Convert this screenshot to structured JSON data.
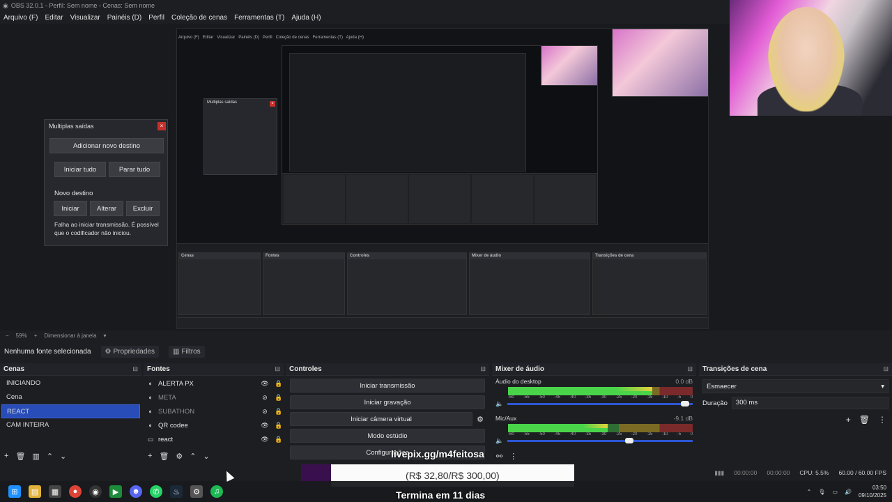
{
  "window": {
    "title": "OBS 32.0.1 - Perfil: Sem nome - Cenas: Sem nome"
  },
  "menu": [
    "Arquivo (F)",
    "Editar",
    "Visualizar",
    "Painéis (D)",
    "Perfil",
    "Coleção de cenas",
    "Ferramentas (T)",
    "Ajuda (H)"
  ],
  "dialog": {
    "title": "Multiplas saídas",
    "add_dest": "Adicionar novo destino",
    "start_all": "Iniciar tudo",
    "stop_all": "Parar tudo",
    "new_dest": "Novo destino",
    "start": "Iniciar",
    "change": "Alterar",
    "delete": "Excluir",
    "error": "Falha ao iniciar transmissão. É possível que o codificador não iniciou."
  },
  "zoom": {
    "value": "59%",
    "mode": "Dimensionar à janela"
  },
  "source_toolbar": {
    "no_source": "Nenhuma fonte selecionada",
    "properties": "Propriedades",
    "filters": "Filtros"
  },
  "scenes": {
    "title": "Cenas",
    "items": [
      "INICIANDO",
      "Cena",
      "REACT",
      "CAM INTEIRA"
    ],
    "active": "REACT"
  },
  "sources": {
    "title": "Fontes",
    "items": [
      {
        "name": "ALERTA PX",
        "icon": "browser-icon",
        "visible": true
      },
      {
        "name": "META",
        "icon": "browser-icon",
        "visible": false
      },
      {
        "name": "SUBATHON",
        "icon": "browser-icon",
        "visible": false
      },
      {
        "name": "QR codee",
        "icon": "browser-icon",
        "visible": true
      },
      {
        "name": "react",
        "icon": "window-icon",
        "visible": true
      }
    ]
  },
  "controls": {
    "title": "Controles",
    "start_stream": "Iniciar transmissão",
    "start_recording": "Iniciar gravação",
    "start_virtual_cam": "Iniciar câmera virtual",
    "studio_mode": "Modo estúdio",
    "settings": "Configurações"
  },
  "mixer": {
    "title": "Mixer de áudio",
    "channels": [
      {
        "name": "Áudio do desktop",
        "db": "0.0 dB",
        "level": 0.78,
        "volume": 0.98
      },
      {
        "name": "Mic/Aux",
        "db": "-9.1 dB",
        "level": 0.54,
        "volume": 0.68
      }
    ],
    "ticks": [
      "-60",
      "-55",
      "-50",
      "-45",
      "-40",
      "-35",
      "-30",
      "-25",
      "-20",
      "-15",
      "-10",
      "-5",
      "0"
    ]
  },
  "transitions": {
    "title": "Transições de cena",
    "selected": "Esmaecer",
    "duration_label": "Duração",
    "duration": "300 ms"
  },
  "status": {
    "rec_time": "00:00:00",
    "stream_time": "00:00:00",
    "cpu": "CPU: 5.5%",
    "fps": "60.00 / 60.00 FPS"
  },
  "overlay": {
    "livepix": "livepix.gg/m4feitosa",
    "goal": "(R$ 32,80/R$ 300,00)",
    "goal_progress": 0.109,
    "ends": "Termina em 11 dias"
  },
  "clock": {
    "time": "03:50",
    "date": "09/10/2025"
  },
  "colors": {
    "accent": "#284cb8",
    "panel": "#1d1e22",
    "meter_green": "#4ad44a"
  }
}
